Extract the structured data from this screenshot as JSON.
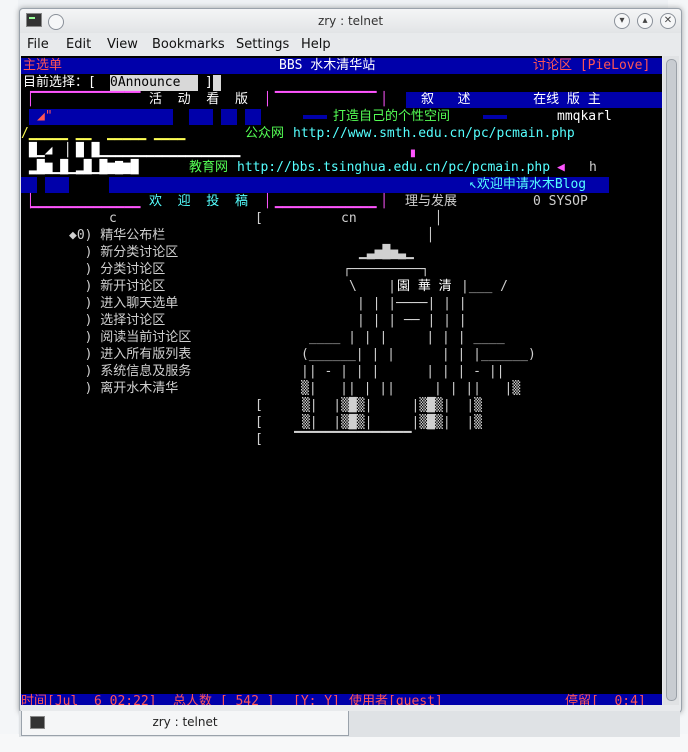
{
  "window": {
    "title": "zry : telnet"
  },
  "menu": [
    "File",
    "Edit",
    "View",
    "Bookmarks",
    "Settings",
    "Help"
  ],
  "header": {
    "left": "主选单",
    "center": "BBS 水木清华站",
    "right": "讨论区 [PieLove]"
  },
  "selection": {
    "label": "目前选择：[",
    "value": "0Announce",
    "close": "]"
  },
  "banner": {
    "activity": "活  动  看  版",
    "top_right": "叙   述        在线 版 主",
    "slogan": "打造自己的个性空间",
    "moderator": "mmqkarl",
    "public_label": "公众网",
    "public_url": "http://www.smth.edu.cn/pc/pcmain.php",
    "edu_label": "教育网",
    "edu_url": "http://bbs.tsinghua.edu.cn/pc/pcmain.php",
    "h": "h",
    "welcome": "↖欢迎申请水木Blog",
    "submit": "欢  迎  投  稿",
    "dev": "理与发展",
    "sysop": "0 SYSOP",
    "c": "c",
    "cn": "cn"
  },
  "menu_items": [
    "◆0) 精华公布栏",
    "  ) 新分类讨论区",
    "  ) 分类讨论区",
    "  ) 新开讨论区",
    "  ) 进入聊天选单",
    "  ) 选择讨论区",
    "  ) 阅读当前讨论区",
    "  ) 进入所有版列表",
    "  ) 系统信息及服务",
    "  ) 离开水木清华"
  ],
  "art_text": "園 華 清",
  "status": {
    "time": "时间[Jul  6 02:22]",
    "total": "总人数 [ 542 ]",
    "yy": "[Y: Y]",
    "user": "使用者[guest]",
    "stay": "停留[  0:4]"
  },
  "taskbar": {
    "label": "zry : telnet"
  }
}
